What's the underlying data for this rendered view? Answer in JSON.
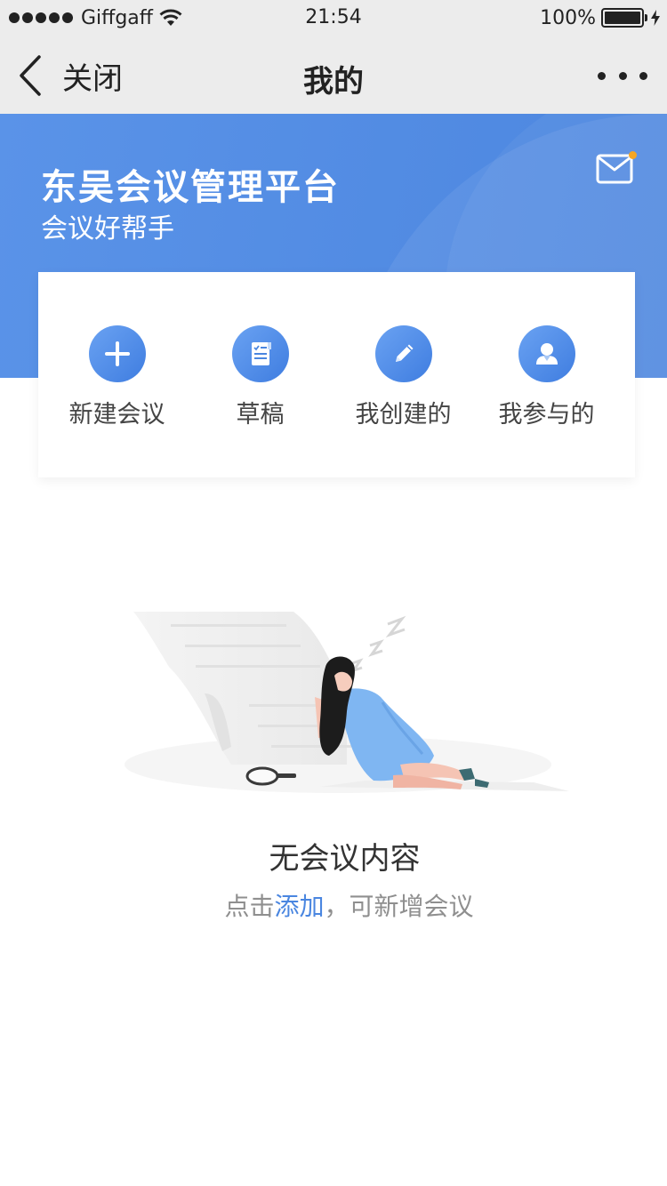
{
  "status_bar": {
    "carrier": "Giffgaff",
    "time": "21:54",
    "battery": "100%"
  },
  "nav": {
    "back_label": "关闭",
    "title": "我的"
  },
  "banner": {
    "title": "东吴会议管理平台",
    "subtitle": "会议好帮手",
    "notification_dot_color": "#f5a623"
  },
  "actions": [
    {
      "label": "新建会议",
      "icon": "plus-icon"
    },
    {
      "label": "草稿",
      "icon": "document-icon"
    },
    {
      "label": "我创建的",
      "icon": "pencil-icon"
    },
    {
      "label": "我参与的",
      "icon": "person-icon"
    }
  ],
  "empty_state": {
    "title": "无会议内容",
    "hint_prefix": "点击",
    "hint_link": "添加",
    "hint_suffix": "，可新增会议"
  },
  "colors": {
    "accent": "#4a86e0",
    "banner": "#5a93e8",
    "nav_bg": "#ececec"
  }
}
